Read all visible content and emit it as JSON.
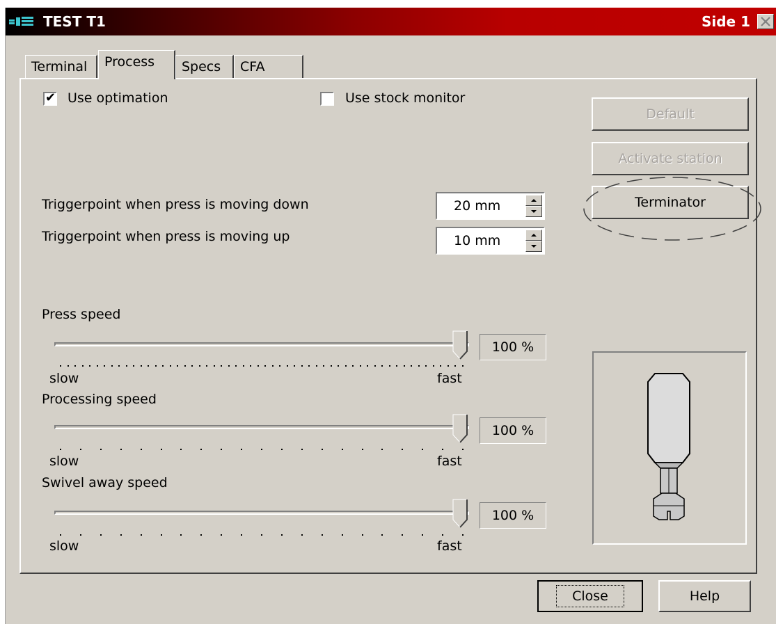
{
  "window": {
    "title": "TEST T1",
    "side_label": "Side 1"
  },
  "tabs": [
    {
      "label": "Terminal"
    },
    {
      "label": "Process"
    },
    {
      "label": "Specs"
    },
    {
      "label": "CFA"
    }
  ],
  "options": {
    "use_optimation": {
      "label": "Use optimation",
      "checked": true
    },
    "use_stock_monitor": {
      "label": "Use stock monitor",
      "checked": false
    }
  },
  "buttons": {
    "default": "Default",
    "activate_station": "Activate station",
    "terminator": "Terminator",
    "close": "Close",
    "help": "Help"
  },
  "triggers": {
    "down": {
      "label": "Triggerpoint when press is moving down",
      "value": "20 mm"
    },
    "up": {
      "label": "Triggerpoint when press is moving up",
      "value": "10 mm"
    }
  },
  "sliders": [
    {
      "label": "Press speed",
      "value": "100 %",
      "level": 1.0,
      "min_label": "slow",
      "max_label": "fast"
    },
    {
      "label": "Processing speed",
      "value": "100 %",
      "level": 1.0,
      "min_label": "slow",
      "max_label": "fast"
    },
    {
      "label": "Swivel away speed",
      "value": "100 %",
      "level": 1.0,
      "min_label": "slow",
      "max_label": "fast"
    }
  ],
  "icons": [
    "app-icon",
    "close-icon",
    "checkmark-icon",
    "spin-up-icon",
    "spin-down-icon",
    "press-tool-icon"
  ]
}
